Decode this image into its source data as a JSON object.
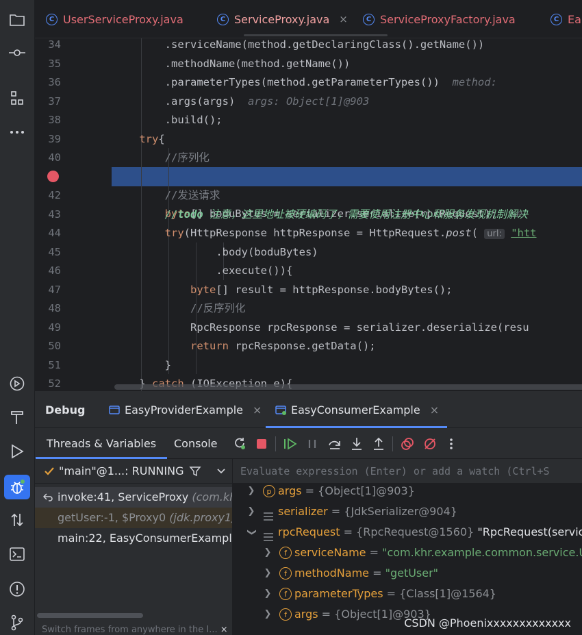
{
  "tabs": [
    {
      "label": "UserServiceProxy.java",
      "active": false
    },
    {
      "label": "ServiceProxy.java",
      "active": true,
      "close": "×"
    },
    {
      "label": "ServiceProxyFactory.java",
      "active": false
    },
    {
      "label": "Ea",
      "active": false
    }
  ],
  "code_lines": [
    {
      "n": "34",
      "code": "        .serviceName(method.getDeclaringClass().getName())"
    },
    {
      "n": "35",
      "code": "        .methodName(method.getName())"
    },
    {
      "n": "36",
      "code": "        .parameterTypes(method.getParameterTypes())",
      "hint": "method:"
    },
    {
      "n": "37",
      "code": "        .args(args)",
      "hint": "args: Object[1]@903"
    },
    {
      "n": "38",
      "code": "        .build();"
    },
    {
      "n": "39",
      "kw": "try",
      "code": "{"
    },
    {
      "n": "40",
      "comment": "//序列化"
    },
    {
      "n": "41",
      "kw": "byte",
      "code": "[] boduBytes = serializer.serialize(rpcRequest);",
      "hint": "se"
    },
    {
      "n": "42",
      "comment": "//发送请求"
    },
    {
      "n": "43",
      "todo": "todo",
      "todo_text": " 注意，这里地址被硬编码了，需要使用注册中心和服务发现机制解决"
    },
    {
      "n": "44",
      "kw": "try",
      "code": "(HttpResponse httpResponse = HttpRequest.",
      "method": "post",
      "url_hint": "url:",
      "str": "\"htt"
    },
    {
      "n": "45",
      "code": ".body(boduBytes)"
    },
    {
      "n": "46",
      "code": ".execute()){"
    },
    {
      "n": "47",
      "kw": "byte",
      "code": "[] result = httpResponse.bodyBytes();"
    },
    {
      "n": "48",
      "comment": "//反序列化"
    },
    {
      "n": "49",
      "code": "RpcResponse rpcResponse = serializer.deserialize(resu"
    },
    {
      "n": "50",
      "kw": "return",
      "code": " rpcResponse.getData();"
    },
    {
      "n": "51",
      "code": "}"
    },
    {
      "n": "52",
      "code": "} ",
      "kw2": "catch",
      "code2": " (IOException e){"
    }
  ],
  "debug": {
    "title": "Debug",
    "sessions": [
      {
        "label": "EasyProviderExample",
        "close": "×"
      },
      {
        "label": "EasyConsumerExample",
        "close": "×"
      }
    ],
    "panel_tabs": [
      "Threads & Variables",
      "Console"
    ],
    "thread": "\"main\"@1...: RUNNING",
    "frames": [
      {
        "method": "invoke:41, ServiceProxy",
        "pkg": "(com.khr"
      },
      {
        "method": "getUser:-1, $Proxy0",
        "pkg": "(jdk.proxy1)"
      },
      {
        "method": "main:22, EasyConsumerExample",
        "pkg": ""
      }
    ],
    "frames_hint": "Switch frames from anywhere in the I...",
    "evaluate_placeholder": "Evaluate expression (Enter) or add a watch (Ctrl+S",
    "variables": [
      {
        "badge": "p",
        "name": "args",
        "value": " = {Object[1]@903}",
        "level": 0
      },
      {
        "badge": "",
        "name": "serializer",
        "value": " = {JdkSerializer@904}",
        "level": 0
      },
      {
        "badge": "",
        "name": "rpcRequest",
        "value": " = {RpcRequest@1560} ",
        "extra": "\"RpcRequest(serviceNa",
        "level": 0,
        "expanded": true
      },
      {
        "badge": "f",
        "name": "serviceName",
        "value": " = ",
        "str": "\"com.khr.example.common.service.Use",
        "level": 1
      },
      {
        "badge": "f",
        "name": "methodName",
        "value": " = ",
        "str": "\"getUser\"",
        "level": 1
      },
      {
        "badge": "f",
        "name": "parameterTypes",
        "value": " = {Class[1]@1564}",
        "level": 1
      },
      {
        "badge": "f",
        "name": "args",
        "value": " = {Object[1]@903}",
        "level": 1
      }
    ]
  },
  "watermark": "CSDN @Phoenixxxxxxxxxxxxx"
}
